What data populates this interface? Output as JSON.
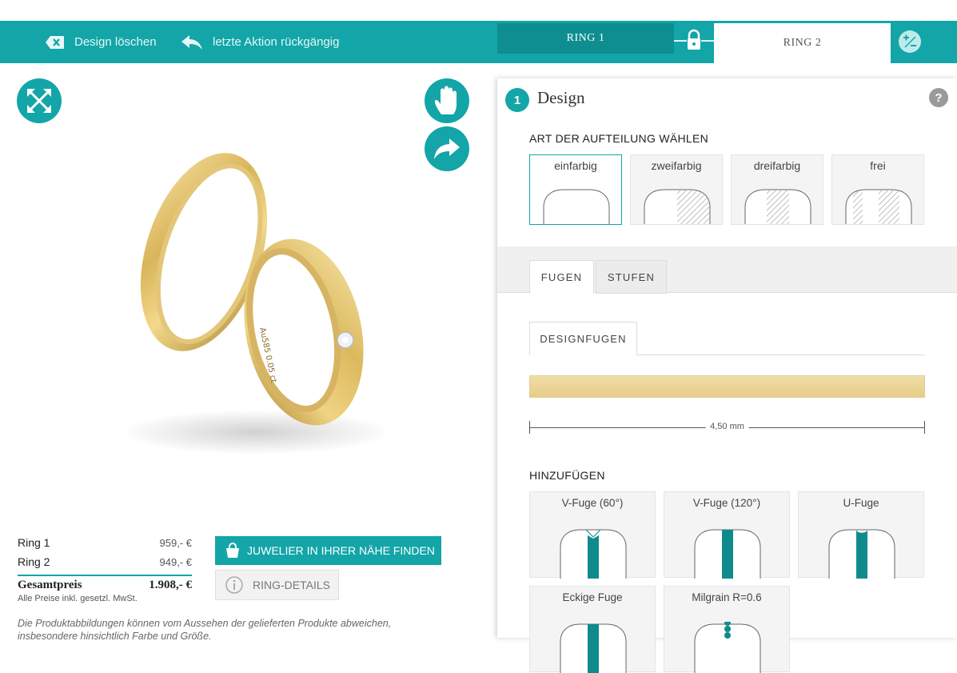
{
  "topbar": {
    "delete_design": "Design löschen",
    "undo": "letzte Aktion rückgängig",
    "ring1_tab": "RING 1",
    "ring2_tab": "RING 2"
  },
  "prices": {
    "ring1_label": "Ring 1",
    "ring1_value": "959,- €",
    "ring2_label": "Ring 2",
    "ring2_value": "949,- €",
    "total_label": "Gesamtpreis",
    "total_value": "1.908,- €",
    "vat_note": "Alle Preise inkl. gesetzl. MwSt."
  },
  "actions": {
    "find_jeweler": "JUWELIER IN IHRER NÄHE FINDEN",
    "ring_details": "RING-DETAILS"
  },
  "disclaimer": "Die Produktabbildungen können vom Aussehen der gelieferten Produkte abweichen, insbesondere hinsichtlich Farbe und Größe.",
  "ring_engraving": "Au585 0.05 ct",
  "panel": {
    "step_number": "1",
    "step_title": "Design",
    "help": "?",
    "split_label": "ART DER AUFTEILUNG WÄHLEN",
    "split_options": [
      "einfarbig",
      "zweifarbig",
      "dreifarbig",
      "frei"
    ],
    "selected_split": "einfarbig",
    "tabs": [
      "FUGEN",
      "STUFEN"
    ],
    "active_tab": "FUGEN",
    "subtab": "DESIGNFUGEN",
    "width_value": "4,50 mm",
    "add_label": "HINZUFÜGEN",
    "fugen": [
      "V-Fuge (60°)",
      "V-Fuge (120°)",
      "U-Fuge",
      "Eckige Fuge",
      "Milgrain R=0.6"
    ]
  },
  "colors": {
    "accent": "#13a5a8",
    "accent_dark": "#0e8e91",
    "gold": "#e6cc87",
    "groove": "#0f8b8d"
  },
  "icons": [
    "close-box-icon",
    "undo-arrow-icon",
    "lock-icon",
    "plus-minus-icon",
    "fullscreen-arrows-icon",
    "hand-icon",
    "share-arrow-icon",
    "shopping-bag-icon",
    "info-icon",
    "help-icon"
  ]
}
